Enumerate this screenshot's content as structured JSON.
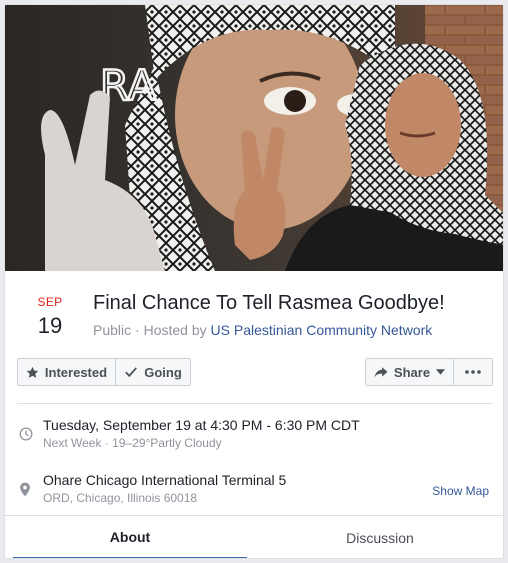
{
  "event": {
    "month": "SEP",
    "day": "19",
    "title": "Final Chance To Tell Rasmea Goodbye!",
    "visibility": "Public",
    "hosted_prefix": " · Hosted by ",
    "host": "US Palestinian Community Network",
    "cover_graffiti_text": "RA"
  },
  "actions": {
    "interested_label": "Interested",
    "going_label": "Going",
    "share_label": "Share",
    "interested_icon": "star-icon",
    "going_icon": "checkmark-icon",
    "share_icon": "share-arrow-icon",
    "more_icon": "ellipsis-icon"
  },
  "details": {
    "time_main": "Tuesday, September 19 at 4:30 PM - 6:30 PM CDT",
    "time_sub": "Next Week · 19–29°Partly Cloudy",
    "location_main": "Ohare Chicago International Terminal 5",
    "location_sub": "ORD, Chicago, Illinois 60018",
    "show_map_label": "Show Map",
    "time_icon": "clock-icon",
    "location_icon": "map-pin-icon"
  },
  "tabs": [
    {
      "label": "About",
      "active": true
    },
    {
      "label": "Discussion",
      "active": false
    }
  ],
  "colors": {
    "accent": "#4267b2",
    "link": "#365899",
    "date_month": "#e2231a",
    "muted_text": "#90949c"
  }
}
